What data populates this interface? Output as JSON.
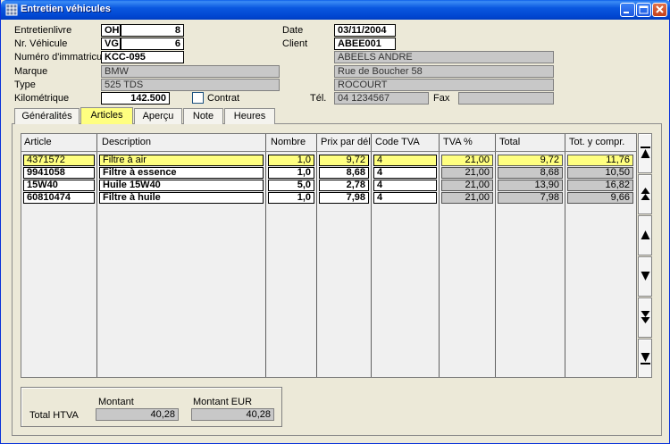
{
  "window": {
    "title": "Entretien véhicules"
  },
  "header": {
    "entretienlivre": {
      "label": "Entretienlivre",
      "code": "OH",
      "num": "8"
    },
    "vehicule": {
      "label": "Nr. Véhicule",
      "code": "VG",
      "num": "6"
    },
    "immatricul": {
      "label": "Numéro d'immatricul",
      "value": "KCC-095"
    },
    "marque": {
      "label": "Marque",
      "value": "BMW"
    },
    "type": {
      "label": "Type",
      "value": "525 TDS"
    },
    "km": {
      "label": "Kilométrique",
      "value": "142.500"
    },
    "contrat": {
      "label": "Contrat",
      "checked": false
    },
    "date": {
      "label": "Date",
      "value": "03/11/2004"
    },
    "client": {
      "label": "Client",
      "value": "ABEE001"
    },
    "client_name": "ABEELS ANDRE",
    "client_street": "Rue de Boucher 58",
    "client_city": "ROCOURT",
    "tel": {
      "label": "Tél.",
      "value": "04 1234567"
    },
    "fax": {
      "label": "Fax",
      "value": ""
    }
  },
  "tabs": [
    {
      "label": "Généralités",
      "active": false
    },
    {
      "label": "Articles",
      "active": true
    },
    {
      "label": "Aperçu",
      "active": false
    },
    {
      "label": "Note",
      "active": false
    },
    {
      "label": "Heures",
      "active": false
    }
  ],
  "table": {
    "columns": [
      "Article",
      "Description",
      "Nombre",
      "Prix par dél",
      "Code TVA",
      "TVA %",
      "Total",
      "Tot. y compr."
    ],
    "rows": [
      {
        "article": "4371572",
        "description": "Filtre à air",
        "nombre": "1,0",
        "prix": "9,72",
        "code_tva": "4",
        "tva_pct": "21,00",
        "total": "9,72",
        "tot_compr": "11,76",
        "selected": true
      },
      {
        "article": "9941058",
        "description": "Filtre à essence",
        "nombre": "1,0",
        "prix": "8,68",
        "code_tva": "4",
        "tva_pct": "21,00",
        "total": "8,68",
        "tot_compr": "10,50",
        "selected": false
      },
      {
        "article": "15W40",
        "description": "Huile 15W40",
        "nombre": "5,0",
        "prix": "2,78",
        "code_tva": "4",
        "tva_pct": "21,00",
        "total": "13,90",
        "tot_compr": "16,82",
        "selected": false
      },
      {
        "article": "60810474",
        "description": "Filtre à huile",
        "nombre": "1,0",
        "prix": "7,98",
        "code_tva": "4",
        "tva_pct": "21,00",
        "total": "7,98",
        "tot_compr": "9,66",
        "selected": false
      }
    ]
  },
  "totals": {
    "montant_label": "Montant",
    "montant_eur_label": "Montant EUR",
    "total_htva_label": "Total HTVA",
    "montant": "40,28",
    "montant_eur": "40,28"
  },
  "colors": {
    "highlight": "#ffff80",
    "readonly": "#c8c8c8",
    "titlebar": "#0a58e0"
  }
}
